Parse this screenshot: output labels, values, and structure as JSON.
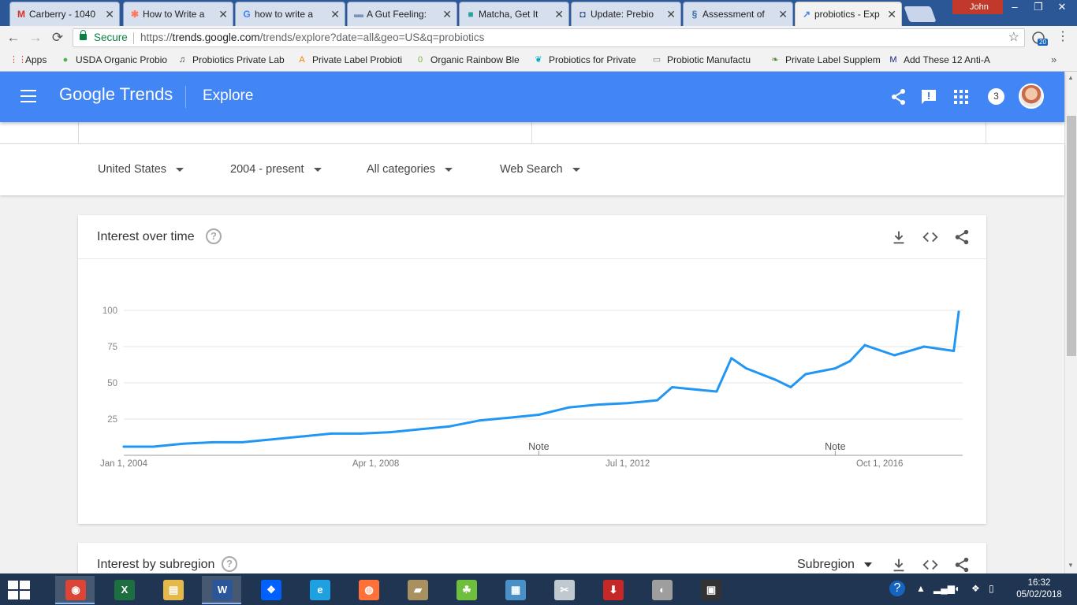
{
  "browser": {
    "tabs": [
      {
        "label": "Carberry - 1040",
        "icon": "gmail-icon",
        "glyph": "M",
        "color": "#d93025",
        "active": false
      },
      {
        "label": "How to Write a",
        "icon": "hubspot-icon",
        "glyph": "✱",
        "color": "#ff7a59",
        "active": false
      },
      {
        "label": "how to write a",
        "icon": "google-icon",
        "glyph": "G",
        "color": "#4285f4",
        "active": false
      },
      {
        "label": "A Gut Feeling:",
        "icon": "dash-icon",
        "glyph": "▬",
        "color": "#7a95b8",
        "active": false
      },
      {
        "label": "Matcha, Get It",
        "icon": "matcha-icon",
        "glyph": "■",
        "color": "#26a69a",
        "active": false
      },
      {
        "label": "Update: Prebio",
        "icon": "shield-icon",
        "glyph": "◘",
        "color": "#2c4a7a",
        "active": false
      },
      {
        "label": "Assessment of",
        "icon": "dna-icon",
        "glyph": "§",
        "color": "#3d6ea5",
        "active": false
      },
      {
        "label": "probiotics - Exp",
        "icon": "trends-icon",
        "glyph": "↗",
        "color": "#4285f4",
        "active": true
      }
    ],
    "user_name": "John",
    "address": {
      "secure_label": "Secure",
      "url_prefix": "https://",
      "url_host": "trends.google.com",
      "url_path": "/trends/explore?date=all&geo=US&q=probiotics"
    },
    "extension_badge": "20",
    "bookmarks": [
      {
        "label": "Apps",
        "icon": "apps-grid-icon",
        "glyph": "⋮⋮",
        "color": "#e53935"
      },
      {
        "label": "USDA Organic Probio",
        "icon": "organic-icon",
        "glyph": "●",
        "color": "#4caf50"
      },
      {
        "label": "Probiotics Private Lab",
        "icon": "music-note-icon",
        "glyph": "♫",
        "color": "#333"
      },
      {
        "label": "Private Label Probioti",
        "icon": "orange-a-icon",
        "glyph": "A",
        "color": "#f57c00"
      },
      {
        "label": "Organic Rainbow Ble",
        "icon": "leaf-icon",
        "glyph": "0",
        "color": "#7cb342"
      },
      {
        "label": "Probiotics for Private",
        "icon": "leaf-swirl-icon",
        "glyph": "❦",
        "color": "#00acc1"
      },
      {
        "label": "Probiotic Manufactu",
        "icon": "page-icon",
        "glyph": "▭",
        "color": "#777"
      },
      {
        "label": "Private Label Supplem",
        "icon": "green-leaf-icon",
        "glyph": "❧",
        "color": "#558b2f"
      },
      {
        "label": "Add These 12 Anti-A",
        "icon": "mm-logo-icon",
        "glyph": "M",
        "color": "#1a237e"
      },
      {
        "label": "",
        "icon": "google-g-icon",
        "glyph": "G",
        "color": "#4285f4"
      }
    ]
  },
  "trends": {
    "logo": "Google Trends",
    "section": "Explore",
    "notification_count": "3",
    "filters": [
      {
        "label": "United States"
      },
      {
        "label": "2004 - present"
      },
      {
        "label": "All categories"
      },
      {
        "label": "Web Search"
      }
    ],
    "interest_card_title": "Interest over time",
    "subregion_card_title": "Interest by subregion",
    "subregion_select": "Subregion",
    "help_glyph": "?"
  },
  "chart_data": {
    "type": "line",
    "y_ticks": [
      100,
      75,
      50,
      25
    ],
    "ylim": [
      0,
      100
    ],
    "x_tick_labels": [
      "Jan 1, 2004",
      "Apr 1, 2008",
      "Jul 1, 2012",
      "Oct 1, 2016"
    ],
    "notes": [
      {
        "label": "Note",
        "date": "2011-01"
      },
      {
        "label": "Note",
        "date": "2016-01"
      }
    ],
    "grid": true,
    "color": "#2196f3",
    "series": [
      {
        "x": [
          "2004-01",
          "2004-07",
          "2005-01",
          "2005-07",
          "2006-01",
          "2006-07",
          "2007-01",
          "2007-07",
          "2008-01",
          "2008-07",
          "2009-01",
          "2009-07",
          "2010-01",
          "2010-07",
          "2011-01",
          "2011-07",
          "2012-01",
          "2012-07",
          "2013-01",
          "2013-04",
          "2013-07",
          "2014-01",
          "2014-04",
          "2014-07",
          "2015-01",
          "2015-04",
          "2015-07",
          "2016-01",
          "2016-04",
          "2016-07",
          "2017-01",
          "2017-07",
          "2018-01",
          "2018-02"
        ],
        "values": [
          6,
          6,
          8,
          9,
          9,
          11,
          13,
          15,
          15,
          16,
          18,
          20,
          24,
          26,
          28,
          33,
          35,
          36,
          38,
          47,
          46,
          44,
          67,
          60,
          52,
          47,
          56,
          60,
          65,
          76,
          69,
          75,
          72,
          99
        ]
      }
    ]
  },
  "taskbar": {
    "apps": [
      {
        "name": "taskbar-chrome",
        "icon": "chrome-icon",
        "glyph": "◉",
        "color": "#db4437",
        "active": true
      },
      {
        "name": "taskbar-excel",
        "icon": "excel-icon",
        "glyph": "X",
        "color": "#1d6f42",
        "active": false
      },
      {
        "name": "taskbar-explorer",
        "icon": "folder-icon",
        "glyph": "▤",
        "color": "#e6b84a",
        "active": false
      },
      {
        "name": "taskbar-word",
        "icon": "word-icon",
        "glyph": "W",
        "color": "#2b579a",
        "active": true
      },
      {
        "name": "taskbar-dropbox",
        "icon": "dropbox-icon",
        "glyph": "❖",
        "color": "#0061fe",
        "active": false
      },
      {
        "name": "taskbar-ie",
        "icon": "internet-explorer-icon",
        "glyph": "e",
        "color": "#1ea1e1",
        "active": false
      },
      {
        "name": "taskbar-firefox",
        "icon": "firefox-icon",
        "glyph": "◍",
        "color": "#ff7139",
        "active": false
      },
      {
        "name": "taskbar-scanner",
        "icon": "scanner-icon",
        "glyph": "▰",
        "color": "#a89060",
        "active": false
      },
      {
        "name": "taskbar-dragon",
        "icon": "dragon-icon",
        "glyph": "☘",
        "color": "#6fbf3f",
        "active": false
      },
      {
        "name": "taskbar-control-panel",
        "icon": "control-panel-icon",
        "glyph": "▦",
        "color": "#4a90c8",
        "active": false
      },
      {
        "name": "taskbar-snipping",
        "icon": "snipping-tool-icon",
        "glyph": "✂",
        "color": "#c0c8d0",
        "active": false
      },
      {
        "name": "taskbar-downloader",
        "icon": "download-icon",
        "glyph": "⬇",
        "color": "#c62828",
        "active": false
      },
      {
        "name": "taskbar-speaker",
        "icon": "speaker-icon",
        "glyph": "◐",
        "color": "#9e9e9e",
        "active": false
      },
      {
        "name": "taskbar-video",
        "icon": "video-icon",
        "glyph": "▣",
        "color": "#333",
        "active": false
      }
    ],
    "time": "16:32",
    "date": "05/02/2018"
  }
}
